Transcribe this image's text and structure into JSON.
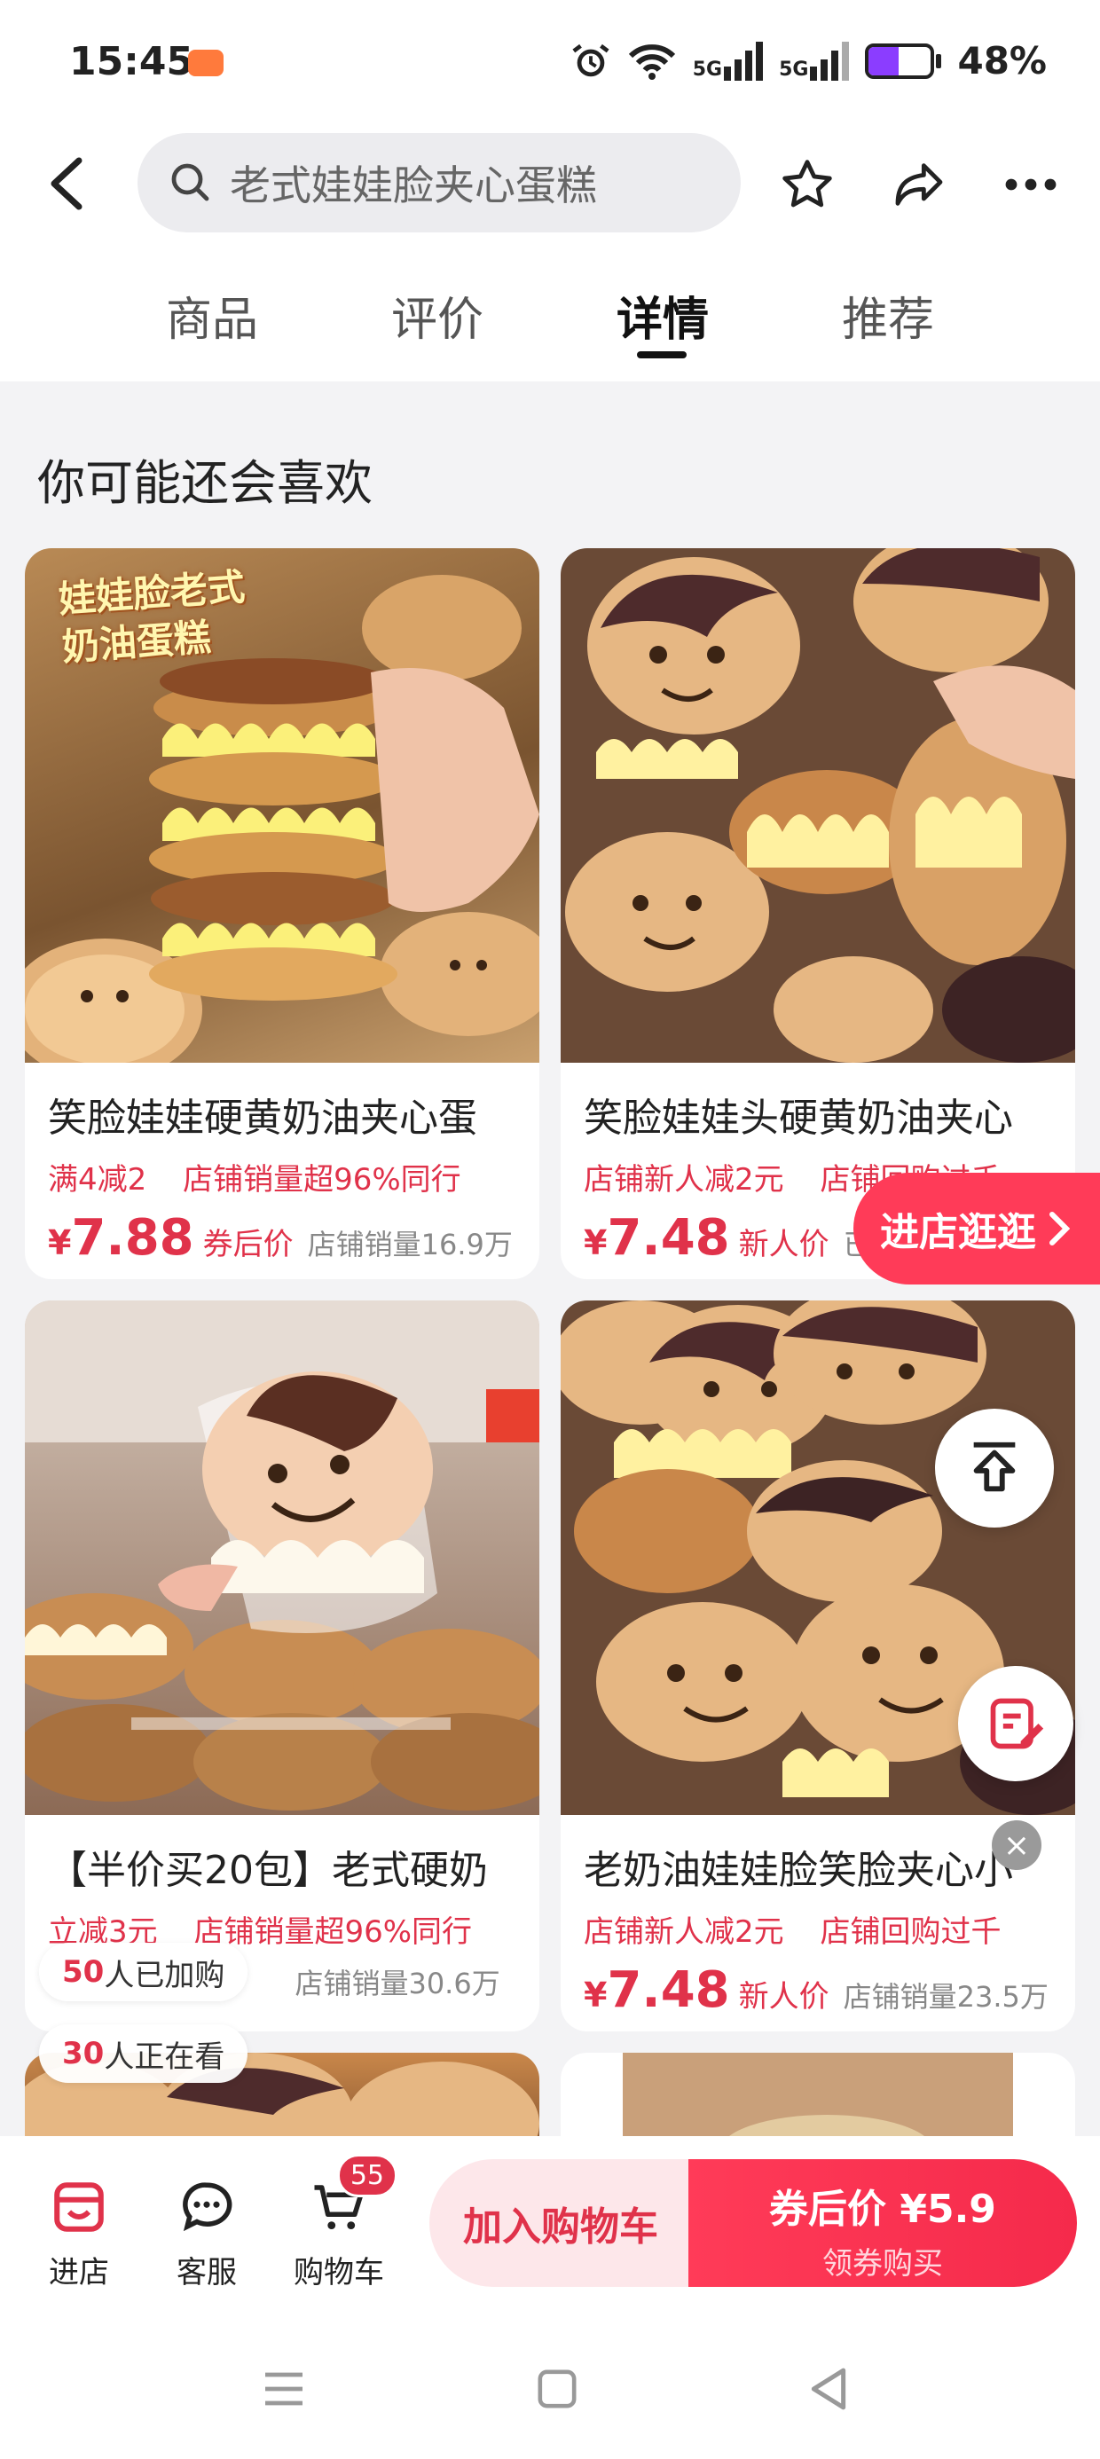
{
  "status_bar": {
    "time": "15:45",
    "signal_1": "5G",
    "signal_2": "5G",
    "battery": "48%",
    "battery_level": 0.48
  },
  "header": {
    "search_placeholder": "老式娃娃脸夹心蛋糕",
    "icons": [
      "back-icon",
      "search-icon",
      "star-icon",
      "share-icon",
      "more-icon"
    ]
  },
  "tabs": [
    {
      "label": "商品",
      "active": false
    },
    {
      "label": "评价",
      "active": false
    },
    {
      "label": "详情",
      "active": true
    },
    {
      "label": "推荐",
      "active": false
    }
  ],
  "section": {
    "title": "你可能还会喜欢"
  },
  "products": [
    {
      "image_overlay": "娃娃脸老式\n奶油蛋糕",
      "title": "笑脸娃娃硬黄奶油夹心蛋",
      "tags": [
        "满4减2",
        "店铺销量超96%同行"
      ],
      "currency": "¥",
      "price": "7.88",
      "price_label": "券后价",
      "sales": "店铺销量16.9万"
    },
    {
      "title": "笑脸娃娃头硬黄奶油夹心",
      "tags": [
        "店铺新人减2元",
        "店铺回购过千"
      ],
      "currency": "¥",
      "price": "7.48",
      "price_label": "新人价",
      "sales": "已售"
    },
    {
      "title": "【半价买20包】老式硬奶",
      "tags": [
        "立减3元",
        "店铺销量超96%同行"
      ],
      "currency": "¥",
      "price": "",
      "price_label": "",
      "sales": "店铺销量30.6万"
    },
    {
      "title": "老奶油娃娃脸笑脸夹心小",
      "tags": [
        "店铺新人减2元",
        "店铺回购过千"
      ],
      "currency": "¥",
      "price": "7.48",
      "price_label": "新人价",
      "sales": "店铺销量23.5万"
    }
  ],
  "floats": {
    "shop_button": "进店逛逛",
    "close": "×",
    "added_count": "50",
    "added_text": "人已加购",
    "viewing_count": "30",
    "viewing_text": "人正在看"
  },
  "bottom_bar": {
    "shop_label": "进店",
    "service_label": "客服",
    "cart_label": "购物车",
    "cart_count": "55",
    "add_cart_label": "加入购物车",
    "buy_label": "券后价 ¥5.9",
    "buy_sub": "领券购买"
  },
  "colors": {
    "accent": "#e0324a",
    "brand_red": "#ff3b58",
    "battery": "#8b3dff"
  }
}
